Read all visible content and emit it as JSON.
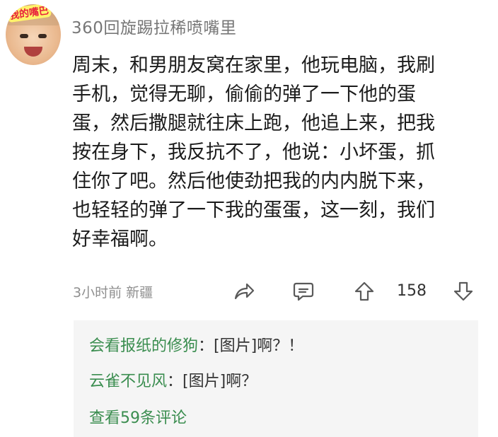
{
  "post": {
    "username": "360回旋踢拉稀喷嘴里",
    "avatar_badge": "我的嘴巴",
    "lines": [
      "周末，和男朋友窝在家里，他玩电脑，我刷",
      "手机，觉得无聊，偷偷的弹了一下他的蛋",
      "蛋，然后撒腿就往床上跑，他追上来，把我",
      "按在身下，我反抗不了，他说：小坏蛋，抓",
      "住你了吧。然后他使劲把我的内内脱下来，",
      "也轻轻的弹了一下我的蛋蛋，这一刻，我们",
      "好幸福啊。"
    ],
    "time": "3小时前",
    "location": "新疆",
    "vote_count": "158"
  },
  "icons": {
    "share": "share-arrow-icon",
    "comment": "comment-bubble-icon",
    "upvote": "arrow-up-icon",
    "downvote": "arrow-down-icon"
  },
  "comments": [
    {
      "name": "会看报纸的修狗",
      "sep": "：",
      "text": "[图片]啊？！"
    },
    {
      "name": "云雀不见风",
      "sep": "：",
      "text": "[图片]啊？"
    }
  ],
  "view_more": "查看59条评论",
  "colors": {
    "comment_name": "#3a8d4f",
    "comment_bg": "#f5f5f5",
    "meta": "#8f8f8f"
  }
}
